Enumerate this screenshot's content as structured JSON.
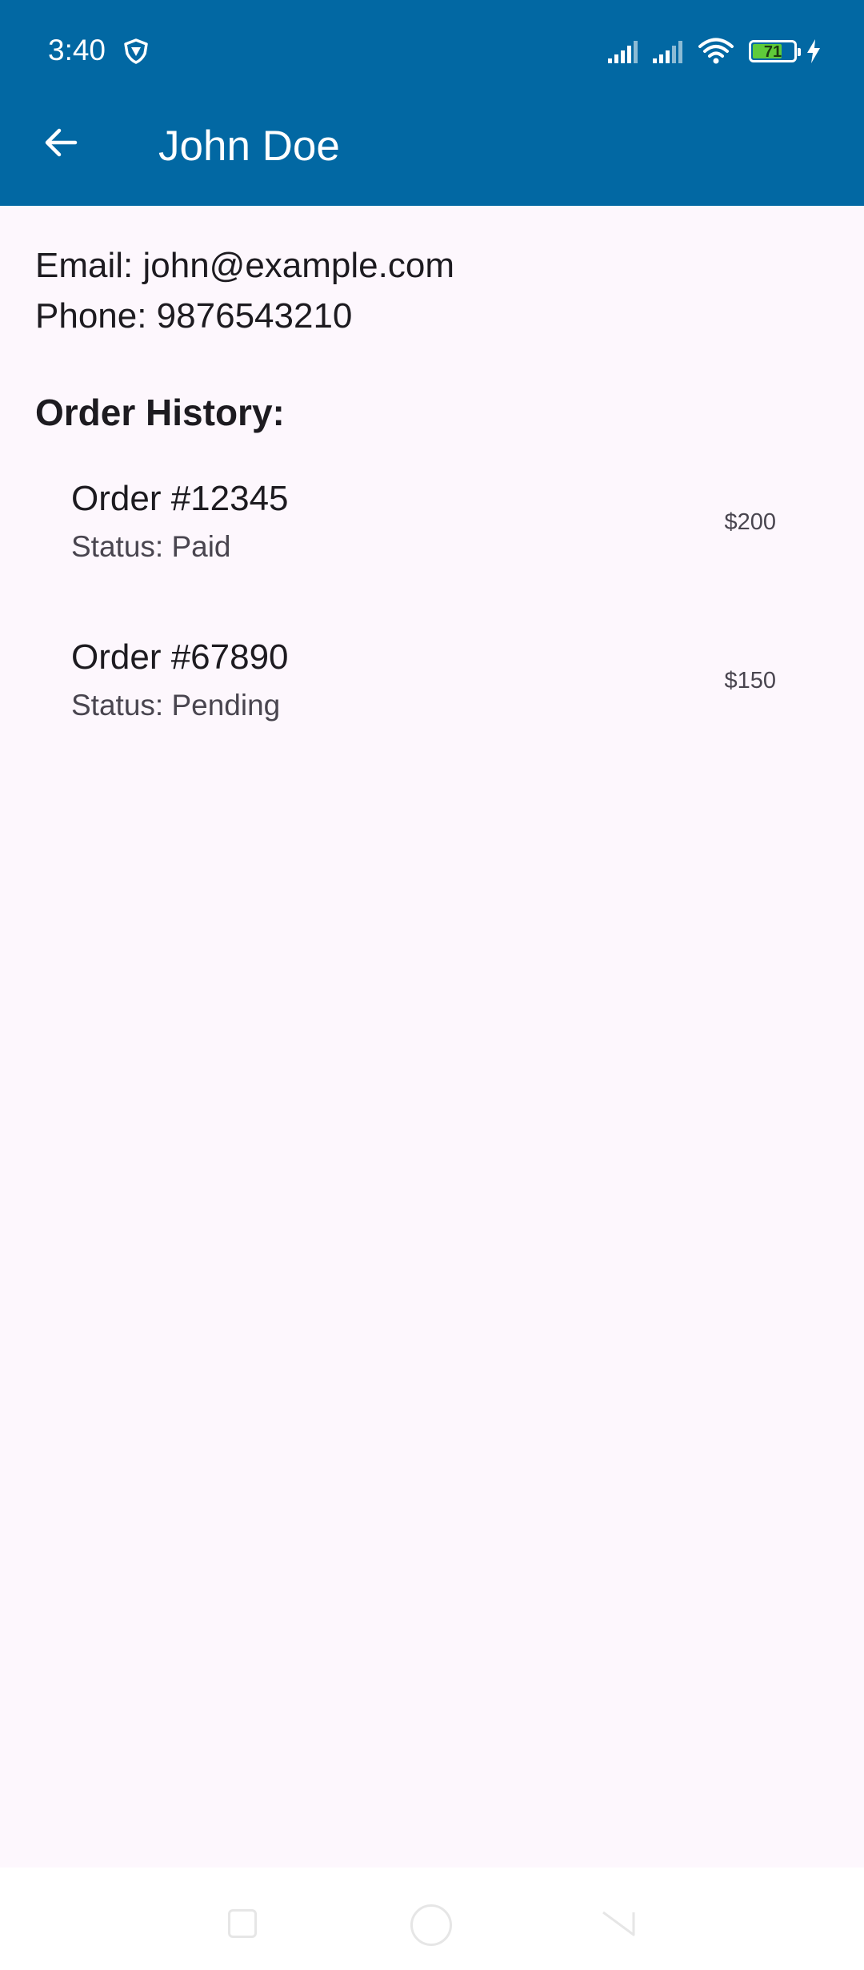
{
  "status_bar": {
    "time": "3:40",
    "battery_level": "71",
    "battery_fraction": 0.71,
    "icons": [
      "shield-icon",
      "signal-icon",
      "signal-icon",
      "wifi-icon",
      "battery-icon",
      "charging-bolt-icon"
    ]
  },
  "header": {
    "title": "John Doe",
    "back_icon": "arrow-left-icon",
    "color": "#0268a3"
  },
  "contact": {
    "email": "Email: john@example.com",
    "phone": "Phone: 9876543210"
  },
  "order_history": {
    "title": "Order History:",
    "orders": [
      {
        "title": "Order #12345",
        "status": "Status: Paid",
        "amount": "$200"
      },
      {
        "title": "Order #67890",
        "status": "Status: Pending",
        "amount": "$150"
      }
    ]
  },
  "nav_bar": {
    "buttons": [
      "recents-icon",
      "home-icon",
      "back-icon"
    ]
  },
  "colors": {
    "accent": "#0268a3",
    "background": "#fdf7fd",
    "battery_fill": "#5fcb3a"
  }
}
